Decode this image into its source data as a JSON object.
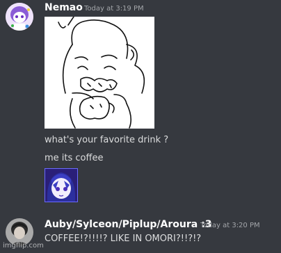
{
  "messages": [
    {
      "author": "Nemao",
      "timestamp": "Today at 3:19 PM",
      "lines": [
        "what's your favorite drink ?",
        "me its coffee"
      ],
      "avatar_icon": "purple-character-avatar",
      "attachments": [
        "drawing-image",
        "character-portrait-image"
      ]
    },
    {
      "author": "Auby/Sylceon/Piplup/Aroura :3",
      "timestamp": "Today at 3:20 PM",
      "lines": [
        "COFFEE!?!!!!? LIKE IN OMORI?!!?!?"
      ],
      "avatar_icon": "grayscale-photo-avatar"
    }
  ],
  "watermark": "imgflip.com",
  "colors": {
    "background": "#36393f",
    "username": "#ffffff",
    "timestamp": "#a3a6aa",
    "text": "#dcddde"
  }
}
